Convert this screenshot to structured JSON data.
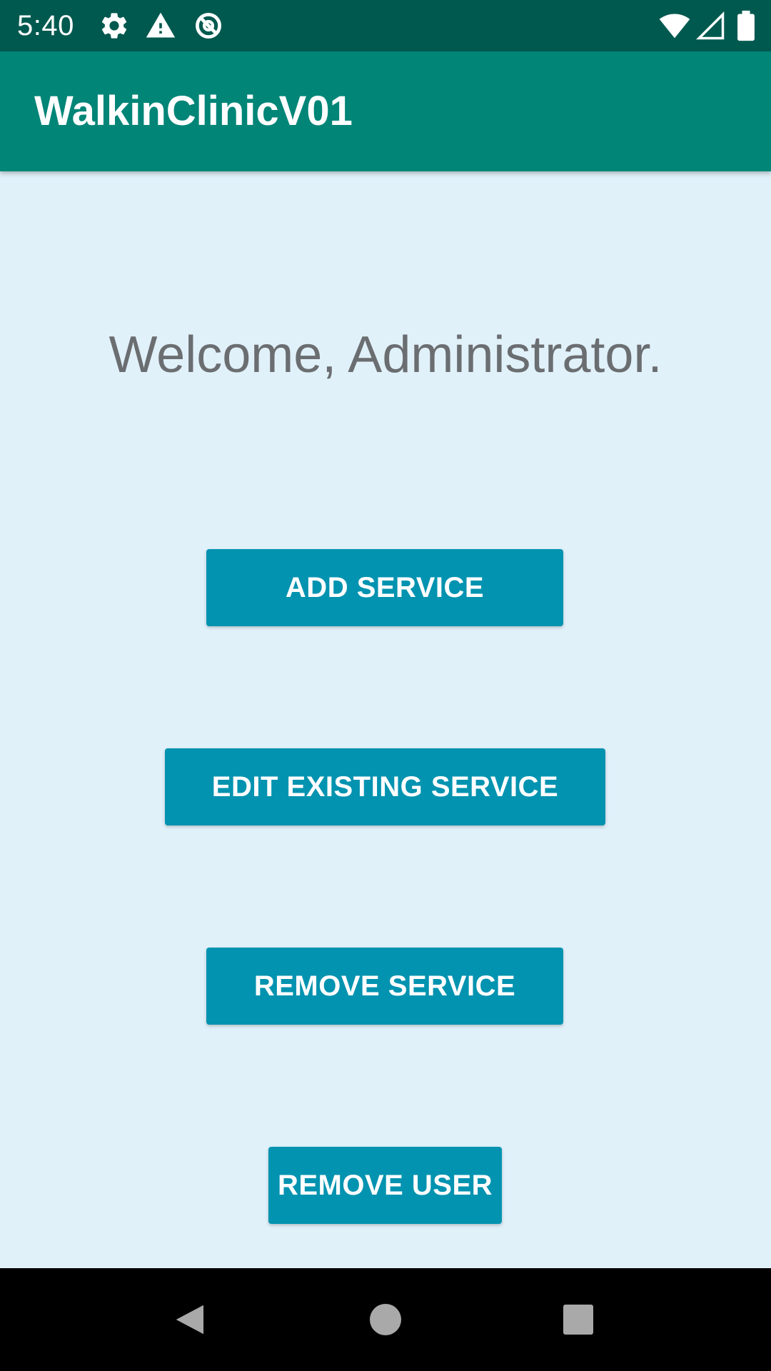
{
  "status_bar": {
    "time": "5:40",
    "icons": [
      "settings-gear-icon",
      "warning-icon",
      "data-saver-icon",
      "wifi-icon",
      "signal-icon",
      "battery-icon"
    ]
  },
  "app_bar": {
    "title": "WalkinClinicV01"
  },
  "main": {
    "welcome_text": "Welcome, Administrator.",
    "buttons": [
      {
        "label": "ADD SERVICE"
      },
      {
        "label": "EDIT EXISTING SERVICE"
      },
      {
        "label": "REMOVE SERVICE"
      },
      {
        "label": "REMOVE USER"
      }
    ]
  },
  "nav_bar": {
    "icons": [
      "back-icon",
      "home-icon",
      "recents-icon"
    ]
  },
  "colors": {
    "status_bar": "#00594F",
    "app_bar": "#008577",
    "background": "#E1F1FA",
    "button": "#0293B0",
    "welcome_text": "#6B6E71"
  }
}
